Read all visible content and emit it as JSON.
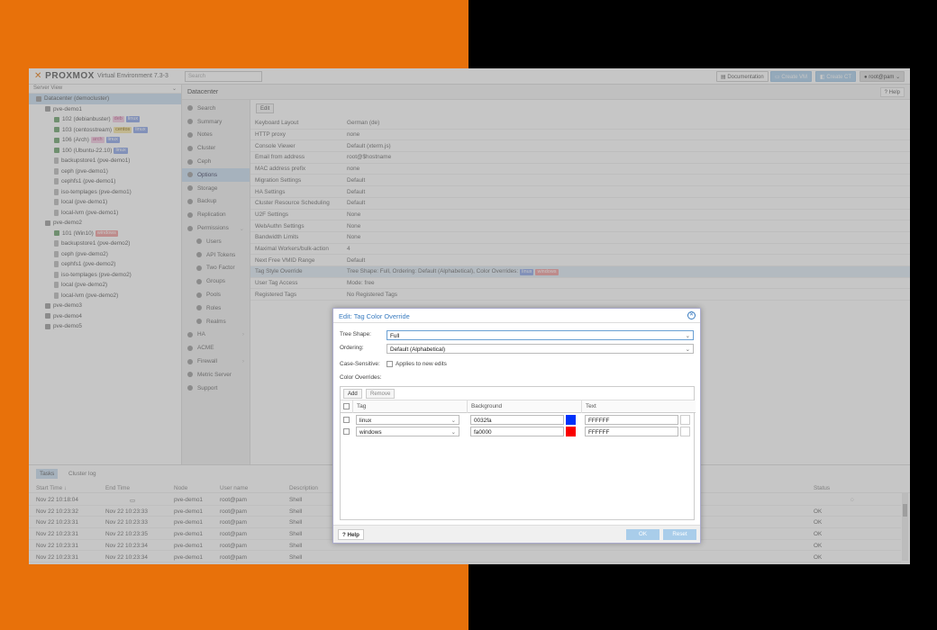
{
  "header": {
    "logo": "PROXMOX",
    "version": "Virtual Environment 7.3-3",
    "search_placeholder": "Search",
    "documentation": "Documentation",
    "create_vm": "Create VM",
    "create_ct": "Create CT",
    "user": "root@pam"
  },
  "tree": {
    "view": "Server View",
    "items": [
      {
        "label": "Datacenter (democluster)",
        "level": 0,
        "icon": "datacenter-icon",
        "selected": true
      },
      {
        "label": "pve-demo1",
        "level": 1,
        "icon": "node-icon"
      },
      {
        "label": "102 (debianbuster)",
        "level": 2,
        "icon": "vm-icon",
        "tags": [
          {
            "t": "deb",
            "bg": "#f3c8e0",
            "fg": "#c05a8a"
          },
          {
            "t": "linux",
            "bg": "#8aa4e8",
            "fg": "#fff"
          }
        ]
      },
      {
        "label": "103 (centosstream)",
        "level": 2,
        "icon": "vm-icon",
        "tags": [
          {
            "t": "centos",
            "bg": "#f7e6a0",
            "fg": "#8a6a10"
          },
          {
            "t": "linux",
            "bg": "#8aa4e8",
            "fg": "#fff"
          }
        ]
      },
      {
        "label": "106 (Arch)",
        "level": 2,
        "icon": "vm-icon",
        "tags": [
          {
            "t": "arch",
            "bg": "#f3c8e0",
            "fg": "#c05a8a"
          },
          {
            "t": "linux",
            "bg": "#8aa4e8",
            "fg": "#fff"
          }
        ]
      },
      {
        "label": "100 (Ubuntu-22.10)",
        "level": 2,
        "icon": "vm-icon",
        "tags": [
          {
            "t": "linux",
            "bg": "#8aa4e8",
            "fg": "#fff"
          }
        ]
      },
      {
        "label": "backupstore1 (pve-demo1)",
        "level": 2,
        "icon": "storage-icon"
      },
      {
        "label": "ceph (pve-demo1)",
        "level": 2,
        "icon": "storage-icon"
      },
      {
        "label": "cephfs1 (pve-demo1)",
        "level": 2,
        "icon": "storage-icon"
      },
      {
        "label": "iso-templages (pve-demo1)",
        "level": 2,
        "icon": "storage-icon"
      },
      {
        "label": "local (pve-demo1)",
        "level": 2,
        "icon": "storage-icon"
      },
      {
        "label": "local-lvm (pve-demo1)",
        "level": 2,
        "icon": "storage-icon"
      },
      {
        "label": "pve-demo2",
        "level": 1,
        "icon": "node-icon"
      },
      {
        "label": "101 (Win10)",
        "level": 2,
        "icon": "vm-icon",
        "tags": [
          {
            "t": "windows",
            "bg": "#f29a9a",
            "fg": "#fff"
          }
        ]
      },
      {
        "label": "backupstore1 (pve-demo2)",
        "level": 2,
        "icon": "storage-icon"
      },
      {
        "label": "ceph (pve-demo2)",
        "level": 2,
        "icon": "storage-icon"
      },
      {
        "label": "cephfs1 (pve-demo2)",
        "level": 2,
        "icon": "storage-icon"
      },
      {
        "label": "iso-templages (pve-demo2)",
        "level": 2,
        "icon": "storage-icon"
      },
      {
        "label": "local (pve-demo2)",
        "level": 2,
        "icon": "storage-icon"
      },
      {
        "label": "local-lvm (pve-demo2)",
        "level": 2,
        "icon": "storage-icon"
      },
      {
        "label": "pve-demo3",
        "level": 1,
        "icon": "node-icon"
      },
      {
        "label": "pve-demo4",
        "level": 1,
        "icon": "node-icon"
      },
      {
        "label": "pve-demo5",
        "level": 1,
        "icon": "node-icon"
      }
    ]
  },
  "content": {
    "title": "Datacenter",
    "help": "Help",
    "edit": "Edit"
  },
  "subnav": [
    {
      "label": "Search",
      "sub": false
    },
    {
      "label": "Summary",
      "sub": false
    },
    {
      "label": "Notes",
      "sub": false
    },
    {
      "label": "Cluster",
      "sub": false
    },
    {
      "label": "Ceph",
      "sub": false
    },
    {
      "label": "Options",
      "sub": false,
      "selected": true
    },
    {
      "label": "Storage",
      "sub": false
    },
    {
      "label": "Backup",
      "sub": false
    },
    {
      "label": "Replication",
      "sub": false
    },
    {
      "label": "Permissions",
      "sub": false,
      "expand": "⌄"
    },
    {
      "label": "Users",
      "sub": true
    },
    {
      "label": "API Tokens",
      "sub": true
    },
    {
      "label": "Two Factor",
      "sub": true
    },
    {
      "label": "Groups",
      "sub": true
    },
    {
      "label": "Pools",
      "sub": true
    },
    {
      "label": "Roles",
      "sub": true
    },
    {
      "label": "Realms",
      "sub": true
    },
    {
      "label": "HA",
      "sub": false,
      "expand": "›"
    },
    {
      "label": "ACME",
      "sub": false
    },
    {
      "label": "Firewall",
      "sub": false,
      "expand": "›"
    },
    {
      "label": "Metric Server",
      "sub": false
    },
    {
      "label": "Support",
      "sub": false
    }
  ],
  "options": [
    {
      "key": "Keyboard Layout",
      "value": "German (de)"
    },
    {
      "key": "HTTP proxy",
      "value": "none"
    },
    {
      "key": "Console Viewer",
      "value": "Default (xterm.js)"
    },
    {
      "key": "Email from address",
      "value": "root@$hostname"
    },
    {
      "key": "MAC address prefix",
      "value": "none"
    },
    {
      "key": "Migration Settings",
      "value": "Default"
    },
    {
      "key": "HA Settings",
      "value": "Default"
    },
    {
      "key": "Cluster Resource Scheduling",
      "value": "Default"
    },
    {
      "key": "U2F Settings",
      "value": "None"
    },
    {
      "key": "WebAuthn Settings",
      "value": "None"
    },
    {
      "key": "Bandwidth Limits",
      "value": "None"
    },
    {
      "key": "Maximal Workers/bulk-action",
      "value": "4"
    },
    {
      "key": "Next Free VMID Range",
      "value": "Default"
    },
    {
      "key": "Tag Style Override",
      "value": "Tree Shape: Full, Ordering: Default (Alphabetical), Color Overrides:",
      "selected": true,
      "tags": [
        {
          "t": "linux",
          "bg": "#8aa4e8",
          "fg": "#fff"
        },
        {
          "t": "windows",
          "bg": "#f29a9a",
          "fg": "#fff"
        }
      ]
    },
    {
      "key": "User Tag Access",
      "value": "Mode: free"
    },
    {
      "key": "Registered Tags",
      "value": "No Registered Tags"
    }
  ],
  "tasks": {
    "tabs": [
      "Tasks",
      "Cluster log"
    ],
    "columns": [
      "Start Time ↓",
      "End Time",
      "Node",
      "User name",
      "Description",
      "Status"
    ],
    "rows": [
      {
        "start": "Nov 22 10:18:04",
        "end": "",
        "node": "pve-demo1",
        "user": "root@pam",
        "desc": "Shell",
        "status": ""
      },
      {
        "start": "Nov 22 10:23:32",
        "end": "Nov 22 10:23:33",
        "node": "pve-demo1",
        "user": "root@pam",
        "desc": "Shell",
        "status": "OK"
      },
      {
        "start": "Nov 22 10:23:31",
        "end": "Nov 22 10:23:33",
        "node": "pve-demo1",
        "user": "root@pam",
        "desc": "Shell",
        "status": "OK"
      },
      {
        "start": "Nov 22 10:23:31",
        "end": "Nov 22 10:23:35",
        "node": "pve-demo1",
        "user": "root@pam",
        "desc": "Shell",
        "status": "OK"
      },
      {
        "start": "Nov 22 10:23:31",
        "end": "Nov 22 10:23:34",
        "node": "pve-demo1",
        "user": "root@pam",
        "desc": "Shell",
        "status": "OK"
      },
      {
        "start": "Nov 22 10:23:31",
        "end": "Nov 22 10:23:34",
        "node": "pve-demo1",
        "user": "root@pam",
        "desc": "Shell",
        "status": "OK"
      }
    ]
  },
  "dialog": {
    "title": "Edit: Tag Color Override",
    "tree_shape_label": "Tree Shape:",
    "tree_shape_value": "Full",
    "ordering_label": "Ordering:",
    "ordering_value": "Default (Alphabetical)",
    "case_label": "Case-Sensitive:",
    "case_option": "Applies to new edits",
    "overrides_label": "Color Overrides:",
    "add": "Add",
    "remove": "Remove",
    "columns": [
      "Tag",
      "Background",
      "Text"
    ],
    "rows": [
      {
        "tag": "linux",
        "bg": "0032fa",
        "bg_color": "#0032fa",
        "text": "FFFFFF"
      },
      {
        "tag": "windows",
        "bg": "fa0000",
        "bg_color": "#fa0000",
        "text": "FFFFFF"
      }
    ],
    "help": "Help",
    "ok": "OK",
    "reset": "Reset"
  },
  "colors": {
    "accent": "#3a7cc0",
    "selected": "#c8dcef",
    "orange": "#e8710a"
  }
}
